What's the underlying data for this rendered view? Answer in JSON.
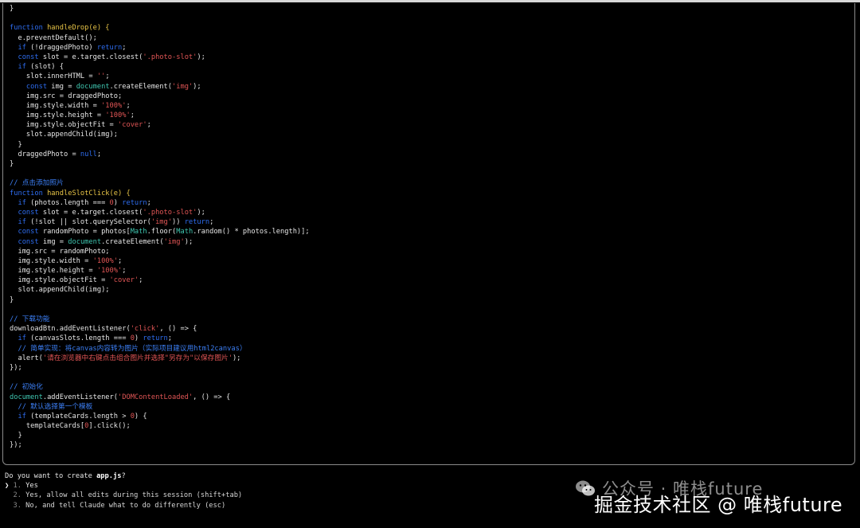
{
  "code": [
    [
      [
        "}",
        "plain"
      ]
    ],
    [],
    [
      [
        "function ",
        "kw"
      ],
      [
        "handleDrop(e) {",
        "fn"
      ]
    ],
    [
      [
        "  e.preventDefault();",
        "plain"
      ]
    ],
    [
      [
        "  if",
        "kw"
      ],
      [
        " (!draggedPhoto) ",
        "plain"
      ],
      [
        "return",
        "kw"
      ],
      [
        ";",
        "plain"
      ]
    ],
    [
      [
        "  const",
        "kw"
      ],
      [
        " slot = e.target.closest(",
        "plain"
      ],
      [
        "'.photo-slot'",
        "str"
      ],
      [
        ");",
        "plain"
      ]
    ],
    [
      [
        "  if",
        "kw"
      ],
      [
        " (slot) {",
        "plain"
      ]
    ],
    [
      [
        "    slot.innerHTML = ",
        "plain"
      ],
      [
        "''",
        "str"
      ],
      [
        ";",
        "plain"
      ]
    ],
    [
      [
        "    const",
        "kw"
      ],
      [
        " img = ",
        "plain"
      ],
      [
        "document",
        "obj"
      ],
      [
        ".createElement(",
        "plain"
      ],
      [
        "'img'",
        "str"
      ],
      [
        ");",
        "plain"
      ]
    ],
    [
      [
        "    img.src = draggedPhoto;",
        "plain"
      ]
    ],
    [
      [
        "    img.style.width = ",
        "plain"
      ],
      [
        "'100%'",
        "str"
      ],
      [
        ";",
        "plain"
      ]
    ],
    [
      [
        "    img.style.height = ",
        "plain"
      ],
      [
        "'100%'",
        "str"
      ],
      [
        ";",
        "plain"
      ]
    ],
    [
      [
        "    img.style.objectFit = ",
        "plain"
      ],
      [
        "'cover'",
        "str"
      ],
      [
        ";",
        "plain"
      ]
    ],
    [
      [
        "    slot.appendChild(img);",
        "plain"
      ]
    ],
    [
      [
        "  }",
        "plain"
      ]
    ],
    [
      [
        "  draggedPhoto = ",
        "plain"
      ],
      [
        "null",
        "kw"
      ],
      [
        ";",
        "plain"
      ]
    ],
    [
      [
        "}",
        "plain"
      ]
    ],
    [],
    [
      [
        "// 点击添加照片",
        "cm"
      ]
    ],
    [
      [
        "function ",
        "kw"
      ],
      [
        "handleSlotClick(e) {",
        "fn"
      ]
    ],
    [
      [
        "  if",
        "kw"
      ],
      [
        " (photos.length === ",
        "plain"
      ],
      [
        "0",
        "num"
      ],
      [
        ") ",
        "plain"
      ],
      [
        "return",
        "kw"
      ],
      [
        ";",
        "plain"
      ]
    ],
    [
      [
        "  const",
        "kw"
      ],
      [
        " slot = e.target.closest(",
        "plain"
      ],
      [
        "'.photo-slot'",
        "str"
      ],
      [
        ");",
        "plain"
      ]
    ],
    [
      [
        "  if",
        "kw"
      ],
      [
        " (!slot || slot.querySelector(",
        "plain"
      ],
      [
        "'img'",
        "str"
      ],
      [
        ")) ",
        "plain"
      ],
      [
        "return",
        "kw"
      ],
      [
        ";",
        "plain"
      ]
    ],
    [
      [
        "  const",
        "kw"
      ],
      [
        " randomPhoto = photos[",
        "plain"
      ],
      [
        "Math",
        "obj"
      ],
      [
        ".floor(",
        "plain"
      ],
      [
        "Math",
        "obj"
      ],
      [
        ".random() * photos.length)];",
        "plain"
      ]
    ],
    [
      [
        "  const",
        "kw"
      ],
      [
        " img = ",
        "plain"
      ],
      [
        "document",
        "obj"
      ],
      [
        ".createElement(",
        "plain"
      ],
      [
        "'img'",
        "str"
      ],
      [
        ");",
        "plain"
      ]
    ],
    [
      [
        "  img.src = randomPhoto;",
        "plain"
      ]
    ],
    [
      [
        "  img.style.width = ",
        "plain"
      ],
      [
        "'100%'",
        "str"
      ],
      [
        ";",
        "plain"
      ]
    ],
    [
      [
        "  img.style.height = ",
        "plain"
      ],
      [
        "'100%'",
        "str"
      ],
      [
        ";",
        "plain"
      ]
    ],
    [
      [
        "  img.style.objectFit = ",
        "plain"
      ],
      [
        "'cover'",
        "str"
      ],
      [
        ";",
        "plain"
      ]
    ],
    [
      [
        "  slot.appendChild(img);",
        "plain"
      ]
    ],
    [
      [
        "}",
        "plain"
      ]
    ],
    [],
    [
      [
        "// 下载功能",
        "cm"
      ]
    ],
    [
      [
        "downloadBtn.addEventListener(",
        "plain"
      ],
      [
        "'click'",
        "str"
      ],
      [
        ", () => {",
        "plain"
      ]
    ],
    [
      [
        "  if",
        "kw"
      ],
      [
        " (canvasSlots.length === ",
        "plain"
      ],
      [
        "0",
        "num"
      ],
      [
        ") ",
        "plain"
      ],
      [
        "return",
        "kw"
      ],
      [
        ";",
        "plain"
      ]
    ],
    [
      [
        "  // 简单实现：将canvas内容转为图片（实际项目建议用html2canvas）",
        "cm"
      ]
    ],
    [
      [
        "  alert(",
        "plain"
      ],
      [
        "'请在浏览器中右键点击组合图片并选择\"另存为\"以保存图片'",
        "str"
      ],
      [
        ");",
        "plain"
      ]
    ],
    [
      [
        "});",
        "plain"
      ]
    ],
    [],
    [
      [
        "// 初始化",
        "cm"
      ]
    ],
    [
      [
        "document",
        "obj"
      ],
      [
        ".addEventListener(",
        "plain"
      ],
      [
        "'DOMContentLoaded'",
        "str"
      ],
      [
        ", () => {",
        "plain"
      ]
    ],
    [
      [
        "  // 默认选择第一个模板",
        "cm"
      ]
    ],
    [
      [
        "  if",
        "kw"
      ],
      [
        " (templateCards.length > ",
        "plain"
      ],
      [
        "0",
        "num"
      ],
      [
        ") {",
        "plain"
      ]
    ],
    [
      [
        "    templateCards[",
        "plain"
      ],
      [
        "0",
        "num"
      ],
      [
        "].click();",
        "plain"
      ]
    ],
    [
      [
        "  }",
        "plain"
      ]
    ],
    [
      [
        "});",
        "plain"
      ]
    ]
  ],
  "prompt": {
    "question_prefix": "Do you want to create ",
    "filename": "app.js",
    "question_suffix": "?",
    "options": [
      {
        "caret": "❯",
        "number": "1.",
        "label": "Yes",
        "selected": true
      },
      {
        "caret": " ",
        "number": "2.",
        "label": "Yes, allow all edits during this session (shift+tab)",
        "selected": false
      },
      {
        "caret": " ",
        "number": "3.",
        "label": "No, and tell Claude what to do differently (esc)",
        "selected": false
      }
    ]
  },
  "watermark": {
    "line1": "公众号 · 唯栈future",
    "line2": "掘金技术社区 @ 唯栈future",
    "icon": "wechat-icon"
  },
  "colors": {
    "keyword": "#2e6df0",
    "function": "#e8c547",
    "string": "#e05555",
    "comment": "#3c7ff5",
    "object": "#3fc6b0",
    "text": "#e6e6e6",
    "background": "#000000"
  }
}
